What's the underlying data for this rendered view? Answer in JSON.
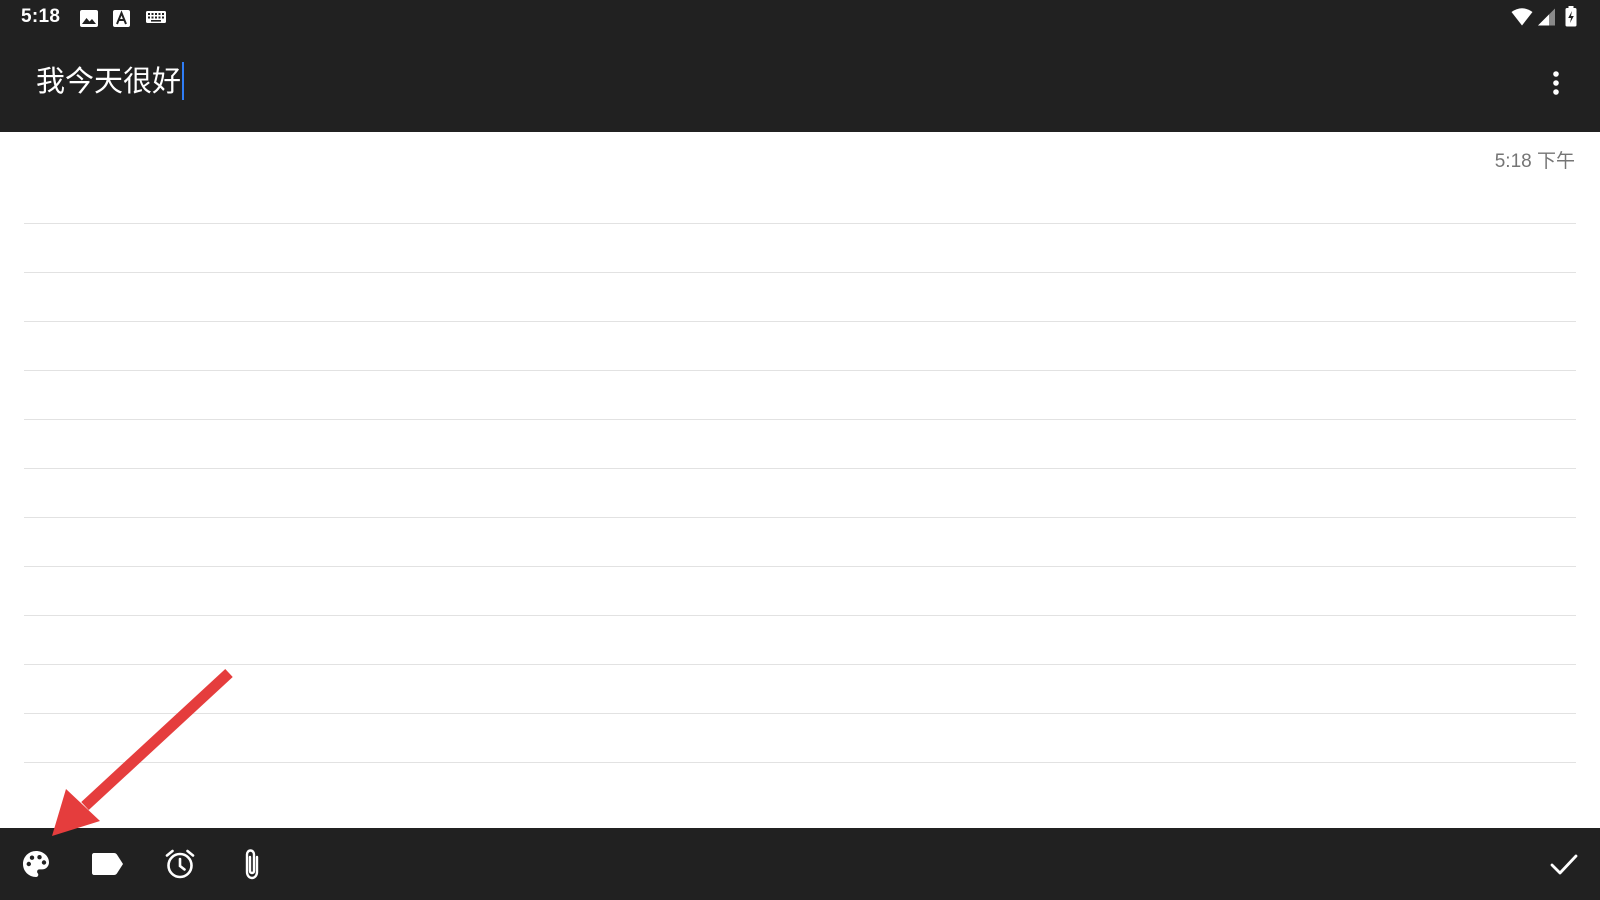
{
  "status_bar": {
    "time": "5:18",
    "left_icons": [
      "image-icon",
      "a-box-icon",
      "keyboard-icon"
    ],
    "right_icons": [
      "wifi-icon",
      "cell-signal-icon",
      "battery-charging-icon"
    ]
  },
  "toolbar": {
    "title_value": "我今天很好",
    "menu_icon": "more-vert-icon"
  },
  "note": {
    "timestamp": "5:18 下午",
    "body": ""
  },
  "bottom_bar": {
    "actions": [
      "palette-icon",
      "label-icon",
      "alarm-icon",
      "attach-icon"
    ],
    "confirm_icon": "check-icon"
  },
  "colors": {
    "bar_background": "#212121",
    "caret": "#2f7df6",
    "annotation_arrow": "#e53d3d",
    "rule_line": "#e2e2e2",
    "timestamp_text": "#757575"
  }
}
